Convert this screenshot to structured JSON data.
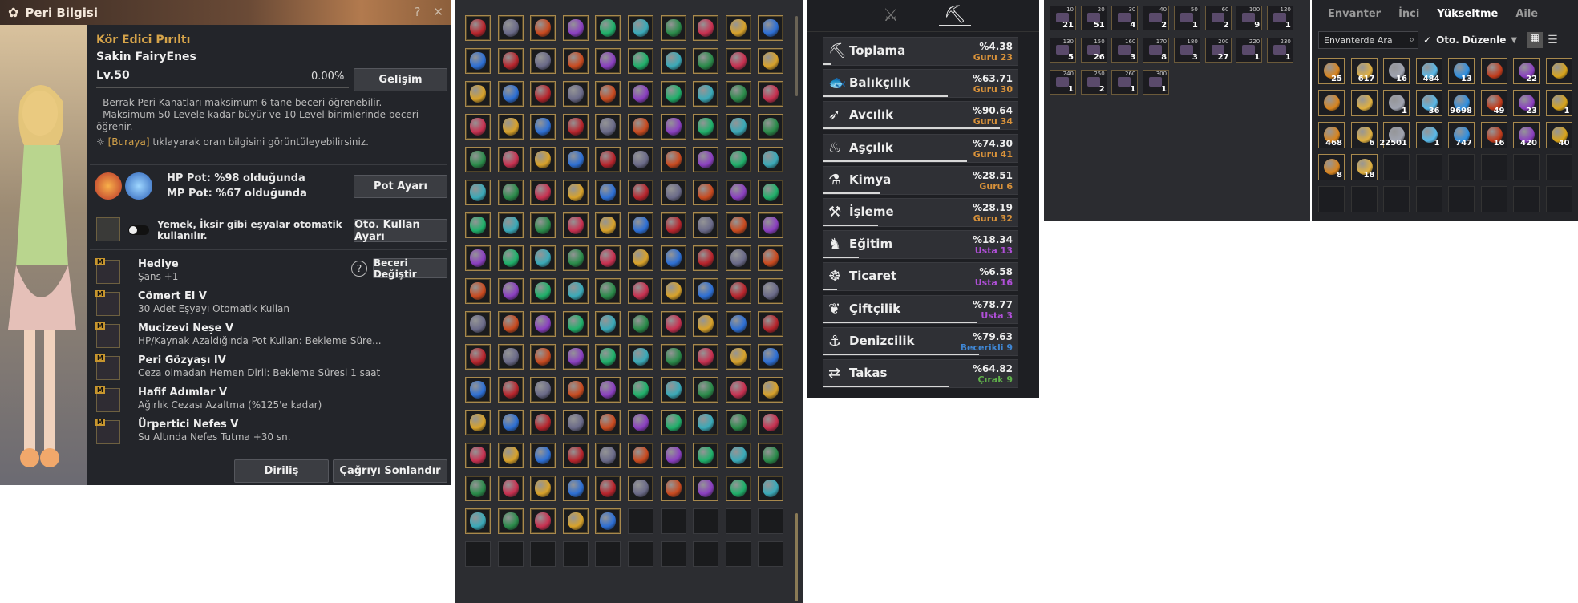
{
  "fairy": {
    "title": "Peri Bilgisi",
    "skill_name": "Kör Edici Pırıltı",
    "fairy_name": "Sakin FairyEnes",
    "level": "Lv.50",
    "percent": "0.00%",
    "grow_btn": "Gelişim",
    "notes": [
      "- Berrak Peri Kanatları maksimum 6 tane beceri öğrenebilir.",
      "- Maksimum 50 Levele kadar büyür ve 10 Level birimlerinde beceri öğrenir."
    ],
    "info_link": "[Buraya]",
    "info_rest": " tıklayarak oran bilgisini görüntüleyebilirsiniz.",
    "hp_pot": "HP Pot: %98 olduğunda",
    "mp_pot": "MP Pot: %67 olduğunda",
    "pot_btn": "Pot Ayarı",
    "auto_text": "Yemek, İksir gibi eşyalar otomatik kullanılır.",
    "auto_btn": "Oto. Kullan Ayarı",
    "change_skill_btn": "Beceri Değiştir",
    "skills": [
      {
        "name": "Hediye",
        "desc": "Şans +1"
      },
      {
        "name": "Cömert El V",
        "desc": "30 Adet Eşyayı Otomatik Kullan"
      },
      {
        "name": "Mucizevi Neşe V",
        "desc": "HP/Kaynak Azaldığında Pot Kullan: Bekleme Süre..."
      },
      {
        "name": "Peri Gözyaşı IV",
        "desc": "Ceza olmadan Hemen Diril: Bekleme Süresi 1 saat"
      },
      {
        "name": "Hafif Adımlar V",
        "desc": "Ağırlık Cezası Azaltma (%125'e kadar)"
      },
      {
        "name": "Ürpertici Nefes V",
        "desc": "Su Altında Nefes Tutma +30 sn."
      }
    ],
    "revive_btn": "Diriliş",
    "end_call_btn": "Çağrıyı Sonlandır"
  },
  "life": {
    "rows": [
      {
        "name": "Toplama",
        "pct": "%4.38",
        "rank": "Guru 23",
        "rank_color": "#d9923a",
        "icon": "pickaxe-icon",
        "glyph": "⛏",
        "fill": 0.04
      },
      {
        "name": "Balıkçılık",
        "pct": "%63.71",
        "rank": "Guru 30",
        "rank_color": "#d9923a",
        "icon": "fish-icon",
        "glyph": "🐟",
        "fill": 0.64
      },
      {
        "name": "Avcılık",
        "pct": "%90.64",
        "rank": "Guru 34",
        "rank_color": "#d9923a",
        "icon": "rifle-icon",
        "glyph": "➶",
        "fill": 0.91
      },
      {
        "name": "Aşçılık",
        "pct": "%74.30",
        "rank": "Guru 41",
        "rank_color": "#d9923a",
        "icon": "cooking-pot-icon",
        "glyph": "♨",
        "fill": 0.74
      },
      {
        "name": "Kimya",
        "pct": "%28.51",
        "rank": "Guru 6",
        "rank_color": "#d9923a",
        "icon": "flask-icon",
        "glyph": "⚗",
        "fill": 0.29
      },
      {
        "name": "İşleme",
        "pct": "%28.19",
        "rank": "Guru 32",
        "rank_color": "#d9923a",
        "icon": "hammer-icon",
        "glyph": "⚒",
        "fill": 0.28
      },
      {
        "name": "Eğitim",
        "pct": "%18.34",
        "rank": "Usta 13",
        "rank_color": "#b04fd8",
        "icon": "horse-icon",
        "glyph": "♞",
        "fill": 0.18
      },
      {
        "name": "Ticaret",
        "pct": "%6.58",
        "rank": "Usta 16",
        "rank_color": "#b04fd8",
        "icon": "wheel-icon",
        "glyph": "☸",
        "fill": 0.07
      },
      {
        "name": "Çiftçilik",
        "pct": "%78.77",
        "rank": "Usta 3",
        "rank_color": "#b04fd8",
        "icon": "sprout-icon",
        "glyph": "❦",
        "fill": 0.79
      },
      {
        "name": "Denizcilik",
        "pct": "%79.63",
        "rank": "Becerikli 9",
        "rank_color": "#3f86d4",
        "icon": "anchor-icon",
        "glyph": "⚓",
        "fill": 0.8
      },
      {
        "name": "Takas",
        "pct": "%64.82",
        "rank": "Çırak 9",
        "rank_color": "#5fb04a",
        "icon": "exchange-icon",
        "glyph": "⇄",
        "fill": 0.65
      }
    ]
  },
  "items": {
    "cells": [
      {
        "top": "10",
        "cnt": "21"
      },
      {
        "top": "20",
        "cnt": "51"
      },
      {
        "top": "30",
        "cnt": "4"
      },
      {
        "top": "40",
        "cnt": "2"
      },
      {
        "top": "50",
        "cnt": "1"
      },
      {
        "top": "60",
        "cnt": "2"
      },
      {
        "top": "100",
        "cnt": "9"
      },
      {
        "top": "120",
        "cnt": "1"
      },
      {
        "top": "130",
        "cnt": "5"
      },
      {
        "top": "150",
        "cnt": "26"
      },
      {
        "top": "160",
        "cnt": "3"
      },
      {
        "top": "170",
        "cnt": "8"
      },
      {
        "top": "180",
        "cnt": "3"
      },
      {
        "top": "200",
        "cnt": "27"
      },
      {
        "top": "220",
        "cnt": "1"
      },
      {
        "top": "230",
        "cnt": "1"
      },
      {
        "top": "240",
        "cnt": "1"
      },
      {
        "top": "250",
        "cnt": "2"
      },
      {
        "top": "260",
        "cnt": "1"
      },
      {
        "top": "300",
        "cnt": "1"
      }
    ]
  },
  "inventory": {
    "tabs": [
      "Envanter",
      "İnci",
      "Yükseltme",
      "Aile"
    ],
    "active_tab": "Yükseltme",
    "search_placeholder": "Envanterde Ara",
    "auto_sort": "Oto. Düzenle",
    "counts": [
      "25",
      "617",
      "16",
      "484",
      "13",
      "",
      "22",
      "",
      "",
      "",
      "1",
      "36",
      "9698",
      "49",
      "23",
      "1",
      "468",
      "6",
      "22501",
      "1",
      "747",
      "16",
      "420",
      "40",
      "8",
      "18"
    ]
  }
}
